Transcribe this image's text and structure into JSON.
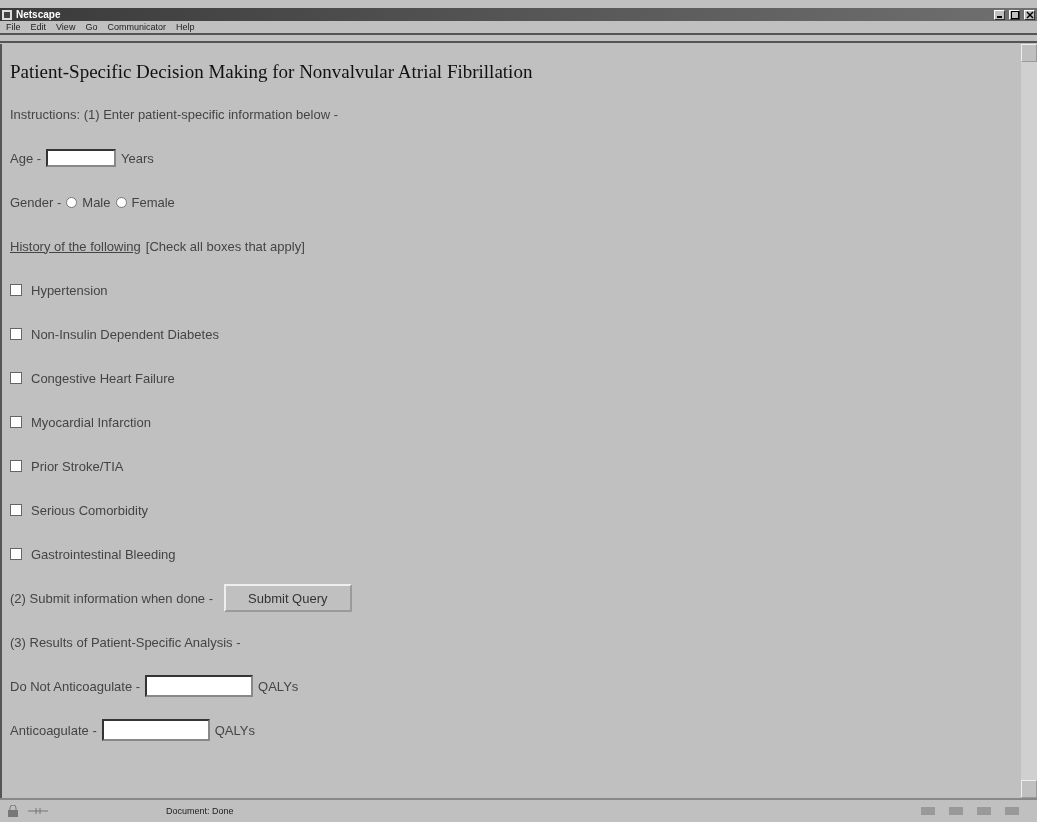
{
  "window": {
    "title": "Netscape"
  },
  "menu": [
    "File",
    "Edit",
    "View",
    "Go",
    "Communicator",
    "Help"
  ],
  "page": {
    "title": "Patient-Specific Decision Making for Nonvalvular Atrial Fibrillation",
    "instructions": "Instructions: (1) Enter patient-specific information below -",
    "age": {
      "label": "Age -",
      "unit": "Years"
    },
    "gender": {
      "label": "Gender -",
      "options": [
        {
          "label": "Male",
          "selected": false
        },
        {
          "label": "Female",
          "selected": false
        }
      ]
    },
    "history": {
      "label": "History of the following",
      "note": "[Check all boxes that apply]"
    },
    "conditions": [
      {
        "label": "Hypertension",
        "checked": false
      },
      {
        "label": "Non-Insulin Dependent Diabetes",
        "checked": false
      },
      {
        "label": "Congestive Heart Failure",
        "checked": false
      },
      {
        "label": "Myocardial Infarction",
        "checked": false
      },
      {
        "label": "Prior Stroke/TIA",
        "checked": false
      },
      {
        "label": "Serious Comorbidity",
        "checked": false
      },
      {
        "label": "Gastrointestinal Bleeding",
        "checked": false
      }
    ],
    "submit": {
      "label": "(2) Submit information when done -",
      "button": "Submit Query"
    },
    "results": "(3) Results of Patient-Specific Analysis -",
    "outputs": [
      {
        "label": "Do Not Anticoagulate -",
        "unit": "QALYs"
      },
      {
        "label": "Anticoagulate -",
        "unit": "QALYs"
      }
    ]
  },
  "status_bar": {
    "text": "Document: Done"
  }
}
